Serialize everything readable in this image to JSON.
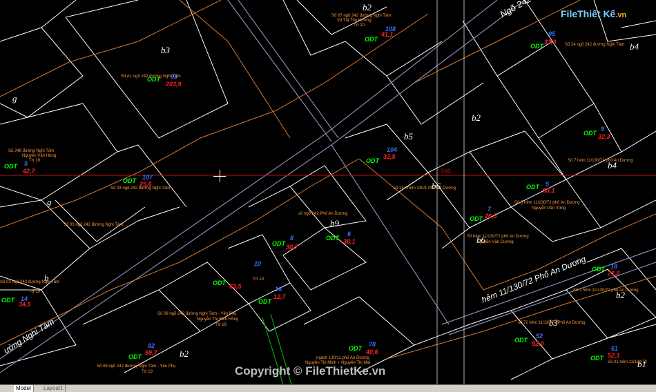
{
  "layout_tabs": [
    "Model",
    "Layout1"
  ],
  "watermark": "Copyright © FileThietKe.vn",
  "logo": {
    "main": "FileThiết Kế",
    "suffix": ".vn"
  },
  "grid_value": "500",
  "streets": [
    {
      "id": "ngo242",
      "text": "Ngõ 242"
    },
    {
      "id": "nghitam",
      "text": "ường Nghi Tàm"
    },
    {
      "id": "hem",
      "text": "hẻm 11/130/72 Phố An Dương"
    }
  ],
  "zones": [
    "b3",
    "b2",
    "g",
    "b5",
    "b4",
    "b9",
    "g",
    "b",
    "b2",
    "b6",
    "b2",
    "b3",
    "b2",
    "b6",
    "b1",
    "b4"
  ],
  "parcels": [
    {
      "odt": "ODT",
      "num": "98",
      "area": "203,9",
      "addr": "Số A1 ngõ 242 đường Nghi Tàm"
    },
    {
      "odt": "ODT",
      "num": "5",
      "area": "42,7",
      "addr": "Số 248 đường Nghi Tàm",
      "owner": "Nguyễn Văn Hùng",
      "sheet": "Tờ 19"
    },
    {
      "odt": "ODT",
      "num": "107",
      "area": "25,6",
      "addr": "Số 03 ngõ 242 đường Nghi Tàm"
    },
    {
      "odt": "ODT",
      "num": "108",
      "area": "41,1",
      "addr": "Số 67 ngõ 242 đường Nghi Tàm",
      "owner": "Vũ Thị Thu Hương",
      "sheet": "Tờ 20"
    },
    {
      "odt": "ODT",
      "num": "95",
      "area": "33,3",
      "addr": "Số 24 ngõ 242 đường Nghi Tàm"
    },
    {
      "odt": "ODT",
      "num": "104",
      "area": "32,5",
      "addr": "số 14A hẻm 130/1 Phố An Dương"
    },
    {
      "odt": "ODT",
      "num": "8",
      "area": "30,7",
      "addr": "số ngõ 242 Phố An Dương"
    },
    {
      "odt": "ODT",
      "num": "6",
      "area": "38,1",
      "addr": "Số 03 ngõ 242 đường Nghi Tàm"
    },
    {
      "odt": "ODT",
      "num": "10",
      "area": "63,5",
      "addr": "Tờ 19"
    },
    {
      "odt": "ODT",
      "num": "5",
      "area": "53,1",
      "addr": "Số 5 hẻm 11/130/72 phố An Dương",
      "owner": "Nguyễn Văn Vững"
    },
    {
      "odt": "ODT",
      "num": "7",
      "area": "26,5",
      "addr": "Số hẻm 11/130/72 phố An Dương",
      "owner": "Nguyễn Văn Cường"
    },
    {
      "odt": "ODT",
      "num": "9",
      "area": "32,3",
      "addr": "Số 7 hẻm 11/130/72 phố An Dương"
    },
    {
      "odt": "ODT",
      "num": "18",
      "area": "21,8",
      "addr": "Số 2 hẻm 11/130/72 phố An Dương"
    },
    {
      "odt": "ODT",
      "num": "14",
      "area": "34,5",
      "addr": "Số 03 ngõ 242 đường Nghi Tàm",
      "sheet": "Tờ 19"
    },
    {
      "odt": "ODT",
      "num": "16",
      "area": "12,7",
      "addr": "Số 08 ngõ 242 đường Nghi Tàm - Yên Phụ",
      "owner": "Nguyễn Thị Bích Hồng",
      "sheet": "Tờ 19"
    },
    {
      "odt": "ODT",
      "num": "52",
      "area": "52,0",
      "addr": "số 72 hẻm 11/130/72 Phố An Dương"
    },
    {
      "odt": "ODT",
      "num": "78",
      "area": "40,6",
      "addr": "ngách 130/11 phố An Dương",
      "owner": "Nguyễn Thị Minh + Nguyễn Thị Mai"
    },
    {
      "odt": "ODT",
      "num": "82",
      "area": "99,7",
      "addr": "Số 08 ngõ 242 đường Nghi Tàm - Yên Phụ",
      "sheet": "Tờ 19"
    },
    {
      "odt": "ODT",
      "num": "61",
      "area": "52,1",
      "addr": "Số 01 hẻm 11/130/72"
    }
  ]
}
